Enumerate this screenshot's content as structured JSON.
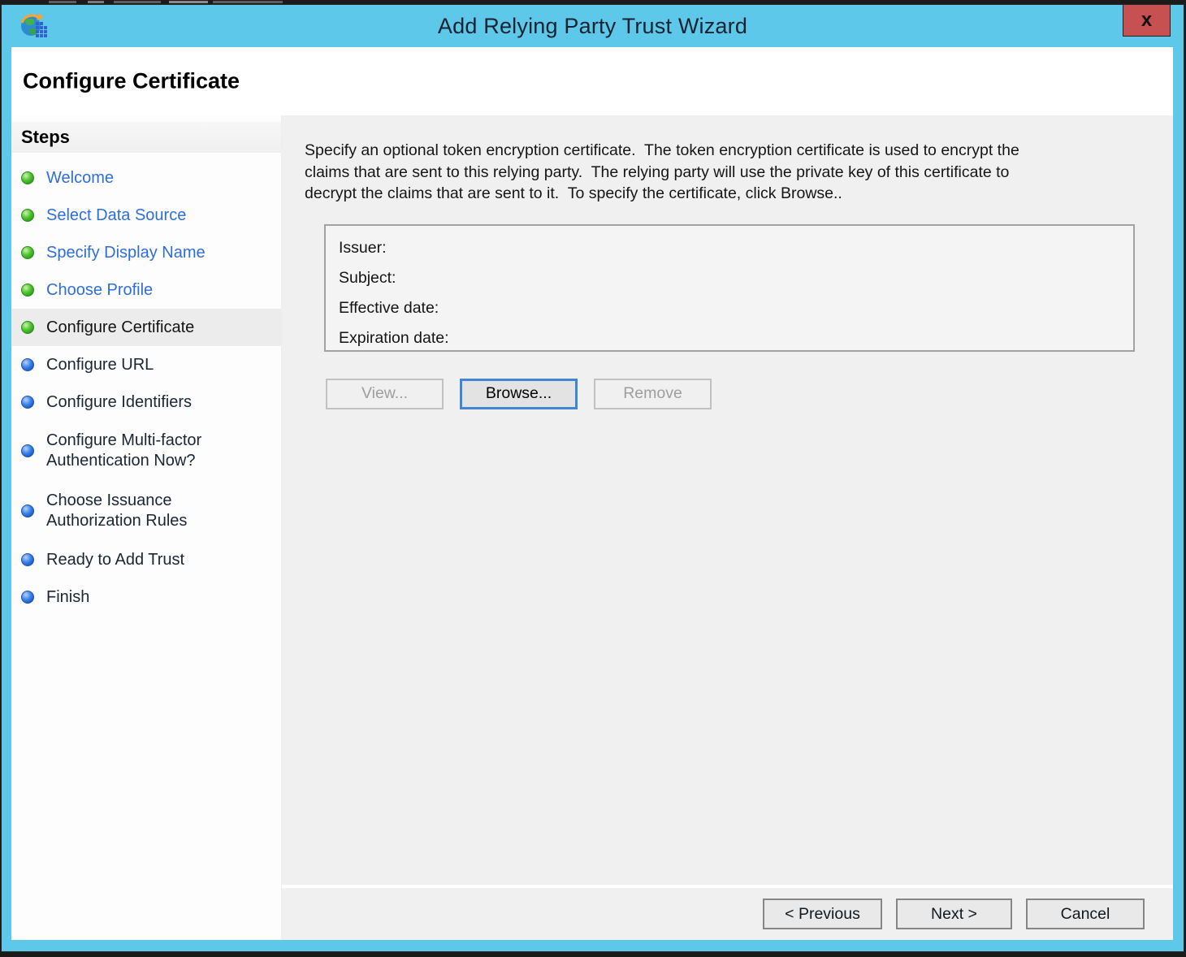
{
  "window": {
    "title": "Add Relying Party Trust Wizard",
    "close_label": "x"
  },
  "page": {
    "heading": "Configure Certificate"
  },
  "steps": {
    "heading": "Steps",
    "items": [
      {
        "label": "Welcome",
        "state": "done"
      },
      {
        "label": "Select Data Source",
        "state": "done"
      },
      {
        "label": "Specify Display Name",
        "state": "done"
      },
      {
        "label": "Choose Profile",
        "state": "done"
      },
      {
        "label": "Configure Certificate",
        "state": "current"
      },
      {
        "label": "Configure URL",
        "state": "upcoming"
      },
      {
        "label": "Configure Identifiers",
        "state": "upcoming"
      },
      {
        "label": "Configure Multi-factor\nAuthentication Now?",
        "state": "upcoming"
      },
      {
        "label": "Choose Issuance\nAuthorization Rules",
        "state": "upcoming"
      },
      {
        "label": "Ready to Add Trust",
        "state": "upcoming"
      },
      {
        "label": "Finish",
        "state": "upcoming"
      }
    ]
  },
  "main": {
    "instruction": "Specify an optional token encryption certificate.  The token encryption certificate is used to encrypt the\nclaims that are sent to this relying party.  The relying party will use the private key of this certificate to\ndecrypt the claims that are sent to it.  To specify the certificate, click Browse..",
    "certificate": {
      "fields": [
        "Issuer:",
        "Subject:",
        "Effective date:",
        "Expiration date:"
      ]
    },
    "buttons": {
      "view": "View...",
      "browse": "Browse...",
      "remove": "Remove"
    }
  },
  "footer": {
    "previous": "< Previous",
    "next": "Next >",
    "cancel": "Cancel"
  },
  "colors": {
    "titlebar": "#5dc8e9",
    "close_button": "#c75050",
    "link": "#2e6edb",
    "panel": "#f0f0f0",
    "selected_row": "#ececec",
    "done_bullet": "#3cb327",
    "upcoming_bullet": "#2a6fdd"
  }
}
